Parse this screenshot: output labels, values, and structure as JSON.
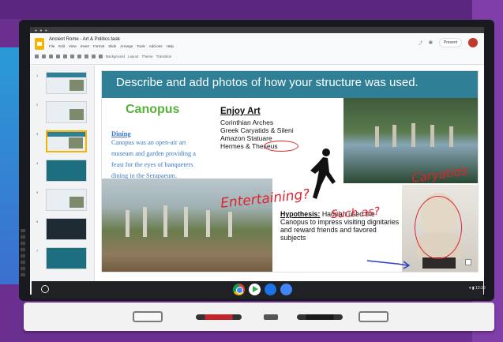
{
  "app": {
    "doc_title": "Ancient Rome - Art & Politics task",
    "menus": [
      "File",
      "Edit",
      "View",
      "Insert",
      "Format",
      "Slide",
      "Arrange",
      "Tools",
      "Add-ons",
      "Help"
    ],
    "toolbar": [
      "Background",
      "Layout",
      "Theme",
      "Transition"
    ],
    "present_label": "Present"
  },
  "filmstrip": {
    "slide_numbers": [
      "1",
      "2",
      "3",
      "4",
      "5",
      "6",
      "7"
    ],
    "selected": 3
  },
  "slide": {
    "title": "Describe and add photos of how your structure was used.",
    "heading": "Canopus",
    "dining_heading": "Dining",
    "dining_text": "Canopus was an open-air art museum and garden providing a feast for the eyes of banqueters dining in the Serapaeum.",
    "enjoy_heading": "Enjoy Art",
    "enjoy_items": [
      "Corinthian Arches",
      "Greek Caryatids & Sileni",
      "Amazon Statuare",
      "Hermes & Theseus"
    ],
    "hypothesis_label": "Hypothesis:",
    "hypothesis_text": "Hadrian used the Canopus to impress visiting dignitaries and reward friends and favored subjects"
  },
  "annotations": {
    "entertaining": "Entertaining?",
    "such_as": "Such as?",
    "caryatids": "Caryatids",
    "ink_color": "#e0242e"
  },
  "shelf": {
    "status": "▾ ▮ 12:30"
  },
  "colors": {
    "header": "#2f7f96",
    "canopus_green": "#58b03c",
    "body_blue": "#3a78c8",
    "backdrop": "#6a2f8f"
  }
}
